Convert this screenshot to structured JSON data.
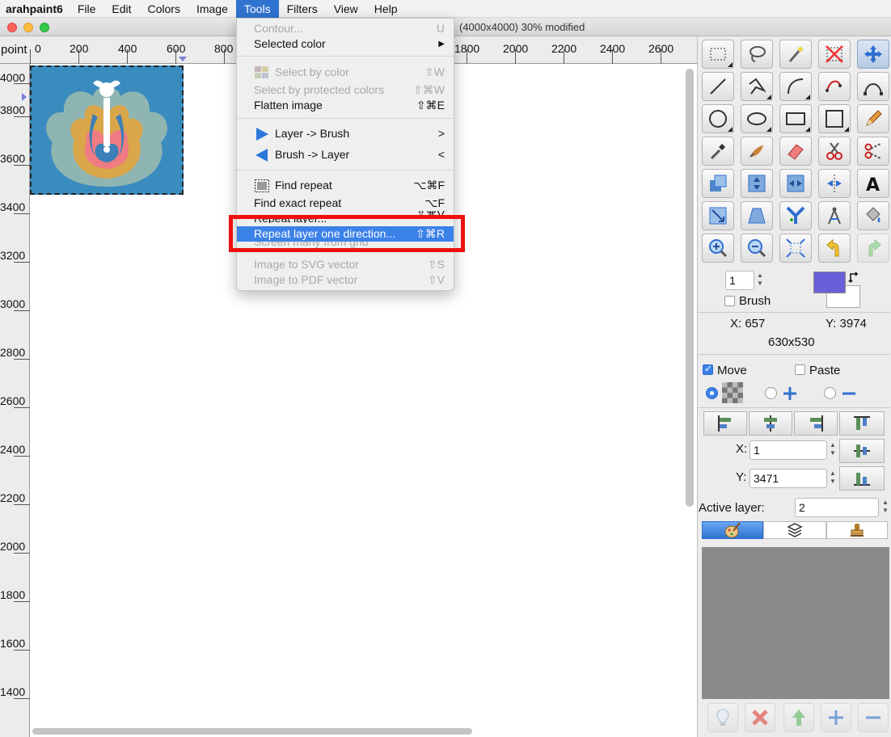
{
  "menubar": {
    "app_name": "arahpaint6",
    "items": [
      "File",
      "Edit",
      "Colors",
      "Image",
      "Tools",
      "Filters",
      "View",
      "Help"
    ],
    "active": "Tools"
  },
  "window": {
    "title": "(4000x4000) 30% modified"
  },
  "rulers": {
    "units_label": "point",
    "top_labels": [
      "0",
      "200",
      "400",
      "600",
      "800",
      "1800",
      "2000",
      "2200",
      "2400",
      "2600"
    ],
    "left_labels": [
      "4000",
      "3800",
      "3600",
      "3400",
      "3200",
      "3000",
      "2800",
      "2600",
      "2400",
      "2200",
      "2000",
      "1800",
      "1600",
      "1400"
    ]
  },
  "tools_menu": {
    "items": [
      {
        "label": "Contour...",
        "shortcut": "U",
        "disabled": true
      },
      {
        "label": "Selected color",
        "shortcut": "▶",
        "disabled": false
      },
      {
        "label": "Select by color",
        "shortcut": "⇧W",
        "disabled": true
      },
      {
        "label": "Select by protected colors",
        "shortcut": "⇧⌘W",
        "disabled": true
      },
      {
        "label": "Flatten image",
        "shortcut": "⇧⌘E",
        "disabled": false
      },
      {
        "label": "Layer -> Brush",
        "shortcut": ">",
        "disabled": false
      },
      {
        "label": "Brush -> Layer",
        "shortcut": "<",
        "disabled": false
      },
      {
        "label": "Find repeat",
        "shortcut": "⌥⌘F",
        "disabled": false
      },
      {
        "label": "Find exact repeat",
        "shortcut": "⌥F",
        "disabled": false
      },
      {
        "label": "Repeat layer...",
        "shortcut": "⇧⌘V",
        "disabled": false
      },
      {
        "label": "Repeat layer one direction...",
        "shortcut": "⇧⌘R",
        "disabled": false,
        "highlighted": true
      },
      {
        "label": "Screen many from grid",
        "shortcut": "",
        "disabled": true
      },
      {
        "label": "Image to SVG vector",
        "shortcut": "⇧S",
        "disabled": true
      },
      {
        "label": "Image to PDF vector",
        "shortcut": "⇧V",
        "disabled": true
      }
    ]
  },
  "panel": {
    "brush_size": "1",
    "brush_label": "Brush",
    "foreground_color": "#6a5fd8",
    "background_color": "#ffffff",
    "coords": {
      "x_label": "X: 657",
      "y_label": "Y: 3974",
      "size": "630x530"
    },
    "move_label": "Move",
    "paste_label": "Paste",
    "pos_x_label": "X:",
    "pos_x_value": "1",
    "pos_y_label": "Y:",
    "pos_y_value": "3471",
    "active_layer_label": "Active layer:",
    "active_layer_value": "2"
  },
  "colors": {
    "accent": "#3b82e8",
    "highlight_frame": "#ee1010",
    "artwork_bg": "#3a8cbf"
  }
}
